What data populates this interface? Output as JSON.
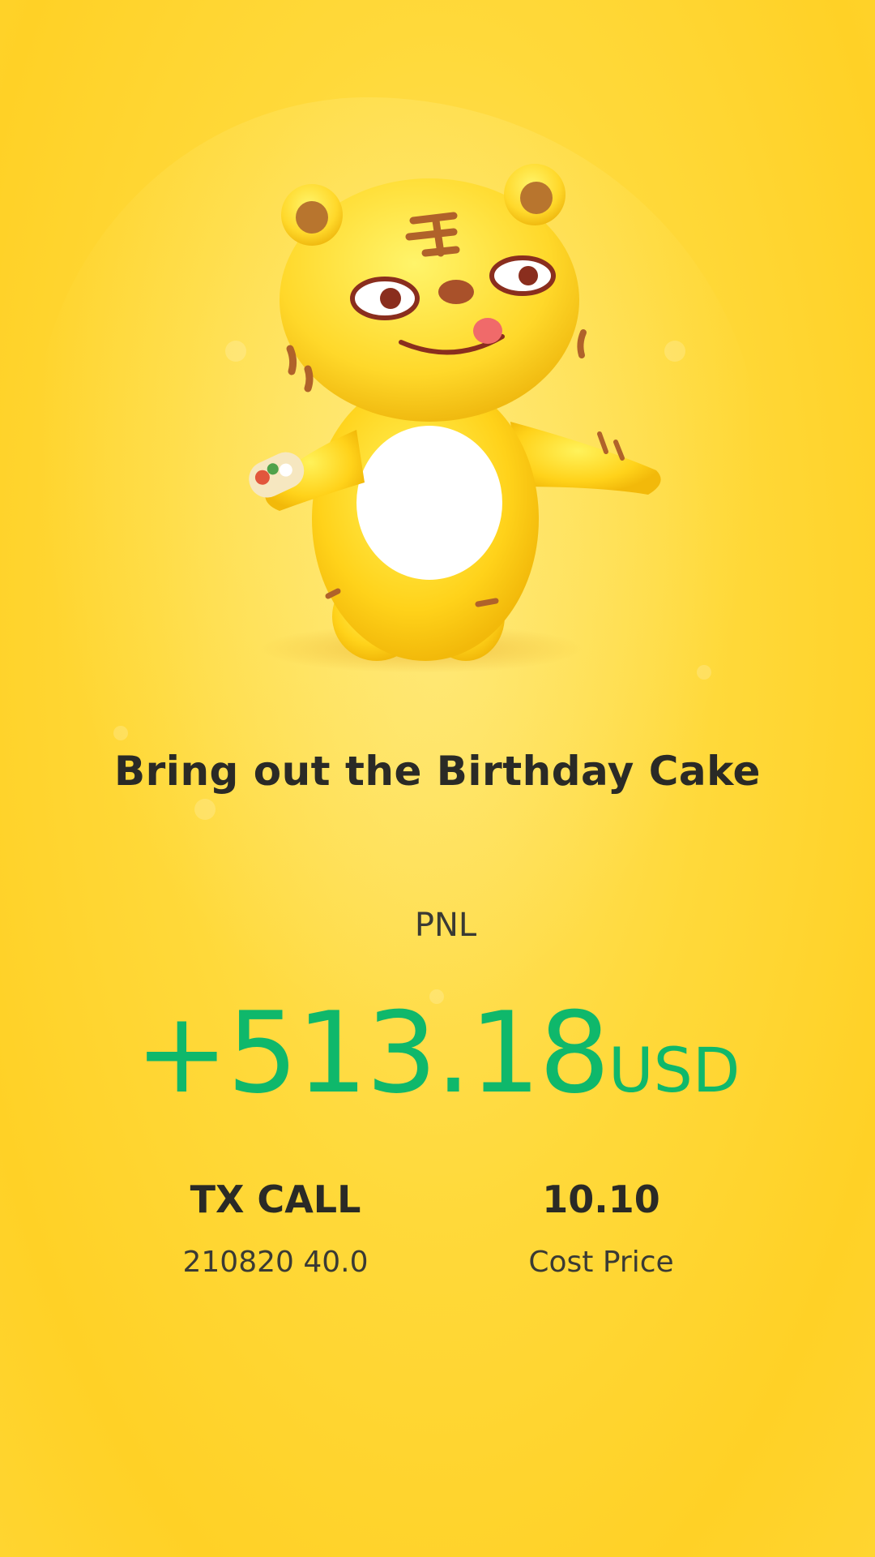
{
  "headline": "Bring out the Birthday Cake",
  "pnl": {
    "label": "PNL",
    "value": "+513.18",
    "unit": "USD"
  },
  "position": {
    "name": "TX CALL",
    "detail": "210820 40.0"
  },
  "cost": {
    "value": "10.10",
    "label": "Cost Price"
  },
  "colors": {
    "background": "#FFD93A",
    "profit_green": "#0FB86B",
    "text_dark": "#2a2a26"
  },
  "icons": {
    "mascot": "tiger-mascot-icon"
  }
}
